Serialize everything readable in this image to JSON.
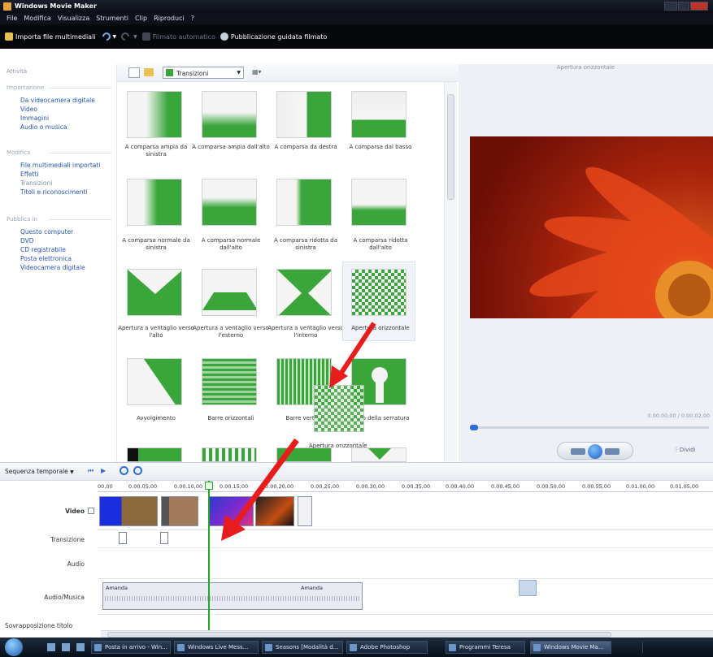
{
  "window": {
    "title": "Windows Movie Maker"
  },
  "menu": [
    "File",
    "Modifica",
    "Visualizza",
    "Strumenti",
    "Clip",
    "Riproduci",
    "?"
  ],
  "toolbar": {
    "import_label": "Importa file multimediali",
    "auto_movie_label": "Filmato automatico",
    "publish_label": "Pubblicazione guidata filmato"
  },
  "tasks": {
    "title": "Attività",
    "sections": [
      {
        "name": "Importazione",
        "links": [
          "Da videocamera digitale",
          "Video",
          "Immagini",
          "Audio o musica"
        ]
      },
      {
        "name": "Modifica",
        "links": [
          "File multimediali importati",
          "Effetti",
          "Transizioni",
          "Titoli e riconoscimenti"
        ]
      },
      {
        "name": "Pubblica in",
        "links": [
          "Questo computer",
          "DVD",
          "CD registrabile",
          "Posta elettronica",
          "Videocamera digitale"
        ]
      }
    ]
  },
  "collection": {
    "dropdown_value": "Transizioni",
    "items": [
      {
        "label": "A comparsa ampia da sinistra",
        "icon": "wipe-wide-left"
      },
      {
        "label": "A comparsa ampia dall'alto",
        "icon": "wipe-wide-top"
      },
      {
        "label": "A comparsa da destra",
        "icon": "wipe-right"
      },
      {
        "label": "A comparsa dal basso",
        "icon": "wipe-bottom"
      },
      {
        "label": "A comparsa normale da sinistra",
        "icon": "wipe-normal-left"
      },
      {
        "label": "A comparsa normale dall'alto",
        "icon": "wipe-normal-top"
      },
      {
        "label": "A comparsa ridotta da sinistra",
        "icon": "wipe-narrow-left"
      },
      {
        "label": "A comparsa ridotta dall'alto",
        "icon": "wipe-narrow-top"
      },
      {
        "label": "Apertura a ventaglio verso l'alto",
        "icon": "fan-up"
      },
      {
        "label": "Apertura a ventaglio verso l'esterno",
        "icon": "fan-out"
      },
      {
        "label": "Apertura a ventaglio verso l'interno",
        "icon": "fan-in"
      },
      {
        "label": "Apertura orizzontale",
        "icon": "checker",
        "selected": true
      },
      {
        "label": "Avvolgimento",
        "icon": "wrap"
      },
      {
        "label": "Barre orizzontali",
        "icon": "bars-horizontal"
      },
      {
        "label": "Barre verticali",
        "icon": "bars-vertical"
      },
      {
        "label": "Buco della serratura",
        "icon": "keyhole"
      }
    ],
    "drag_label": "Apertura orizzontale"
  },
  "preview": {
    "title": "Apertura orizzontale",
    "time": "0.00.00,00 / 0.00.02,00",
    "split_label": "Dividi"
  },
  "timeline": {
    "view_label": "Sequenza temporale",
    "ruler": [
      "00,00",
      "0.00.05,00",
      "0.00.10,00",
      "0.00.15,00",
      "0.00.20,00",
      "0.00.25,00",
      "0.00.30,00",
      "0.00.35,00",
      "0.00.40,00",
      "0.00.45,00",
      "0.00.50,00",
      "0.00.55,00",
      "0.01.00,00",
      "0.01.05,00"
    ],
    "tracks": {
      "video": "Video",
      "transition": "Transizione",
      "audio": "Audio",
      "music": "Audio/Musica",
      "title_overlay": "Sovrapposizione titolo"
    },
    "music_clip_labels": [
      "Amanda",
      "Amanda"
    ]
  },
  "taskbar": [
    "Posta in arrivo - Win...",
    "Windows Live Mess...",
    "Seasons [Modalità d...",
    "Adobe Photoshop",
    "Programmi Teresa",
    "Windows Movie Ma..."
  ],
  "colors": {
    "accent_green": "#3aa53a",
    "selection_blue": "#2b6fd6",
    "arrow_red": "#e81c1c",
    "playhead_green": "#22a822"
  }
}
